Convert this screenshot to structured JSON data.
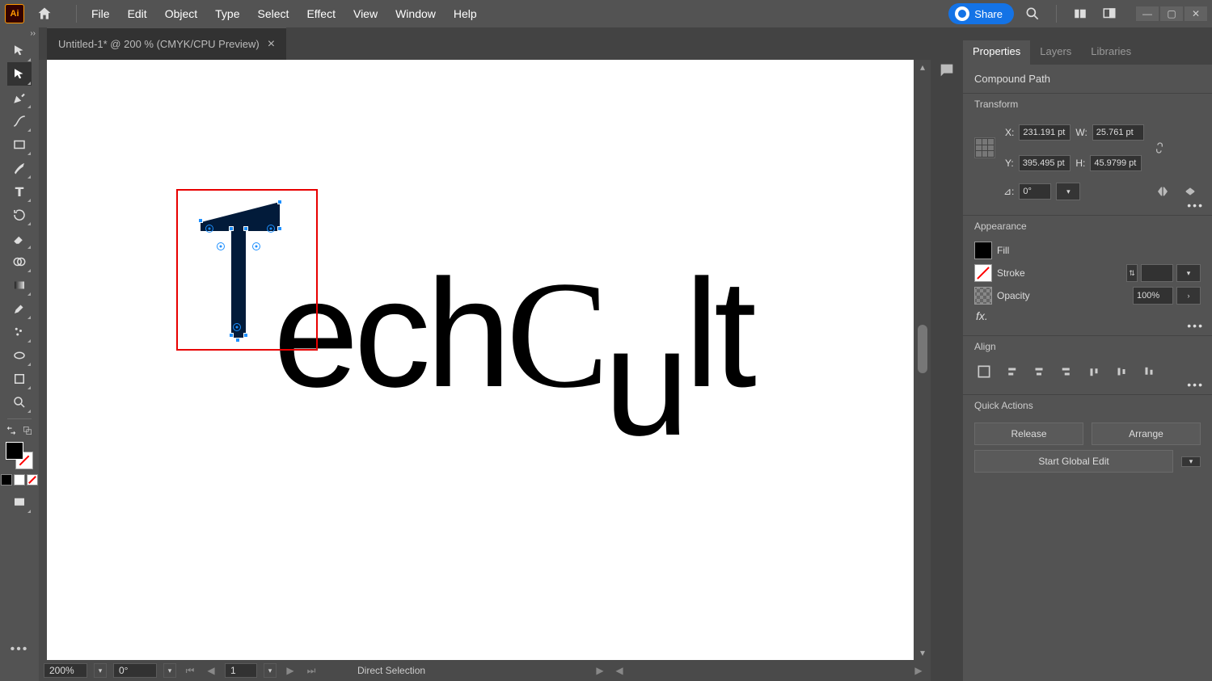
{
  "menubar": {
    "items": [
      "File",
      "Edit",
      "Object",
      "Type",
      "Select",
      "Effect",
      "View",
      "Window",
      "Help"
    ],
    "share": "Share"
  },
  "tab": {
    "title": "Untitled-1* @ 200 % (CMYK/CPU Preview)"
  },
  "status": {
    "zoom": "200%",
    "rotation": "0°",
    "page": "1",
    "tool": "Direct Selection"
  },
  "panel": {
    "tabs": [
      "Properties",
      "Layers",
      "Libraries"
    ],
    "objectType": "Compound Path",
    "transform": {
      "title": "Transform",
      "x": "231.191 pt",
      "y": "395.495 pt",
      "w": "25.761 pt",
      "h": "45.9799 pt",
      "angle": "0°"
    },
    "appearance": {
      "title": "Appearance",
      "fill": "Fill",
      "stroke": "Stroke",
      "opacityLabel": "Opacity",
      "opacity": "100%"
    },
    "align": {
      "title": "Align"
    },
    "quick": {
      "title": "Quick Actions",
      "release": "Release",
      "arrange": "Arrange",
      "global": "Start Global Edit"
    }
  },
  "canvasText": "echCult"
}
